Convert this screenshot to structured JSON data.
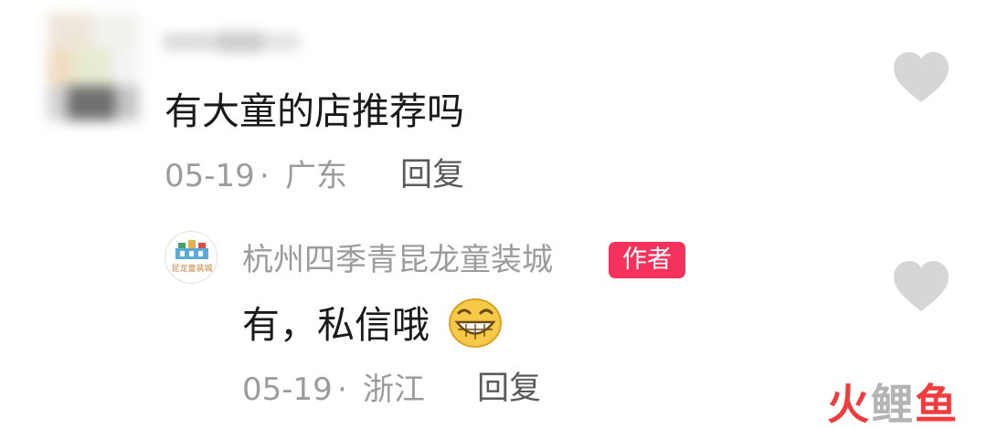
{
  "colors": {
    "text_primary": "#1a1a1a",
    "text_meta": "#9b9b9b",
    "reply_button": "#5a5a5a",
    "like_icon": "#d6d6d6",
    "author_badge_bg": "#f5315c",
    "watermark_accent": "#f03c3c",
    "watermark_gray": "#b4b4b4"
  },
  "comment": {
    "text": "有大童的店推荐吗",
    "date": "05-19",
    "separator": "·",
    "location": "广东",
    "reply_label": "回复",
    "like_icon": "heart-icon"
  },
  "reply": {
    "author_name": "杭州四季青昆龙童装城",
    "author_badge": "作者",
    "avatar_text": "昆龙童装城",
    "text": "有，私信哦",
    "emoji": "grinning-face-emoji",
    "date": "05-19",
    "separator": "·",
    "location": "浙江",
    "reply_label": "回复",
    "like_icon": "heart-icon"
  },
  "watermark": {
    "char1": "火",
    "char2": "鲤",
    "char3": "鱼"
  }
}
